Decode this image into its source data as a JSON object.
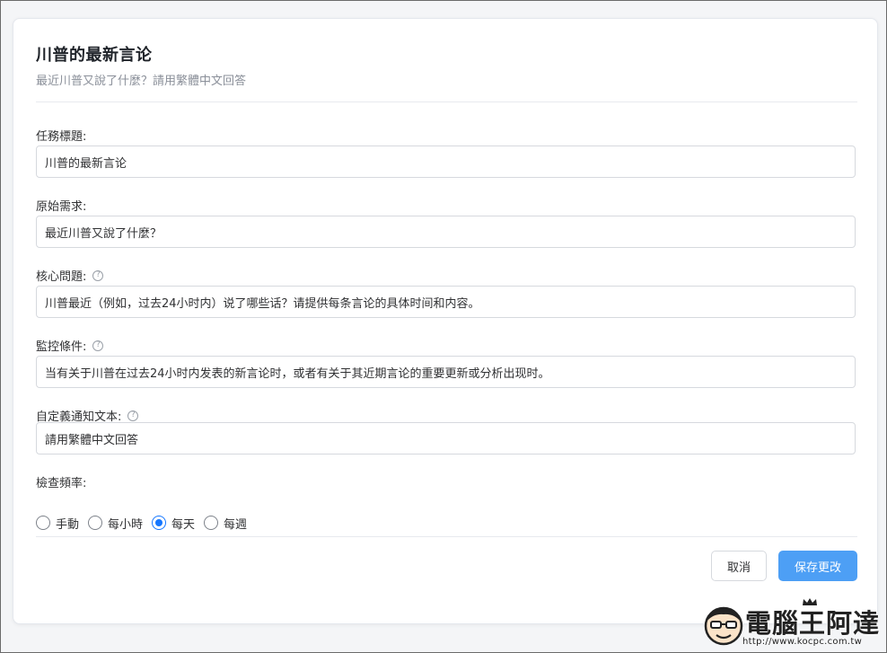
{
  "card": {
    "title": "川普的最新言论",
    "subtitle": "最近川普又說了什麼？請用繁體中文回答"
  },
  "fields": {
    "task_title": {
      "label": "任務標題:",
      "value": "川普的最新言论"
    },
    "original_request": {
      "label": "原始需求:",
      "value": "最近川普又說了什麼？"
    },
    "core_question": {
      "label": "核心問題:",
      "value": "川普最近（例如，过去24小时内）说了哪些话？请提供每条言论的具体时间和内容。"
    },
    "monitor_condition": {
      "label": "監控條件:",
      "value": "当有关于川普在过去24小时内发表的新言论时，或者有关于其近期言论的重要更新或分析出现时。"
    },
    "custom_notification": {
      "label": "自定義通知文本:",
      "value": "請用繁體中文回答"
    }
  },
  "frequency": {
    "label": "檢查頻率:",
    "options": [
      {
        "label": "手動",
        "checked": false
      },
      {
        "label": "每小時",
        "checked": false
      },
      {
        "label": "每天",
        "checked": true
      },
      {
        "label": "每週",
        "checked": false
      }
    ]
  },
  "actions": {
    "cancel_label": "取消",
    "save_label": "保存更改"
  },
  "watermark": {
    "brand": "電腦王阿達",
    "url": "http://www.kocpc.com.tw"
  },
  "colors": {
    "accent": "#1677ff",
    "save_button": "#4d9ff5"
  }
}
